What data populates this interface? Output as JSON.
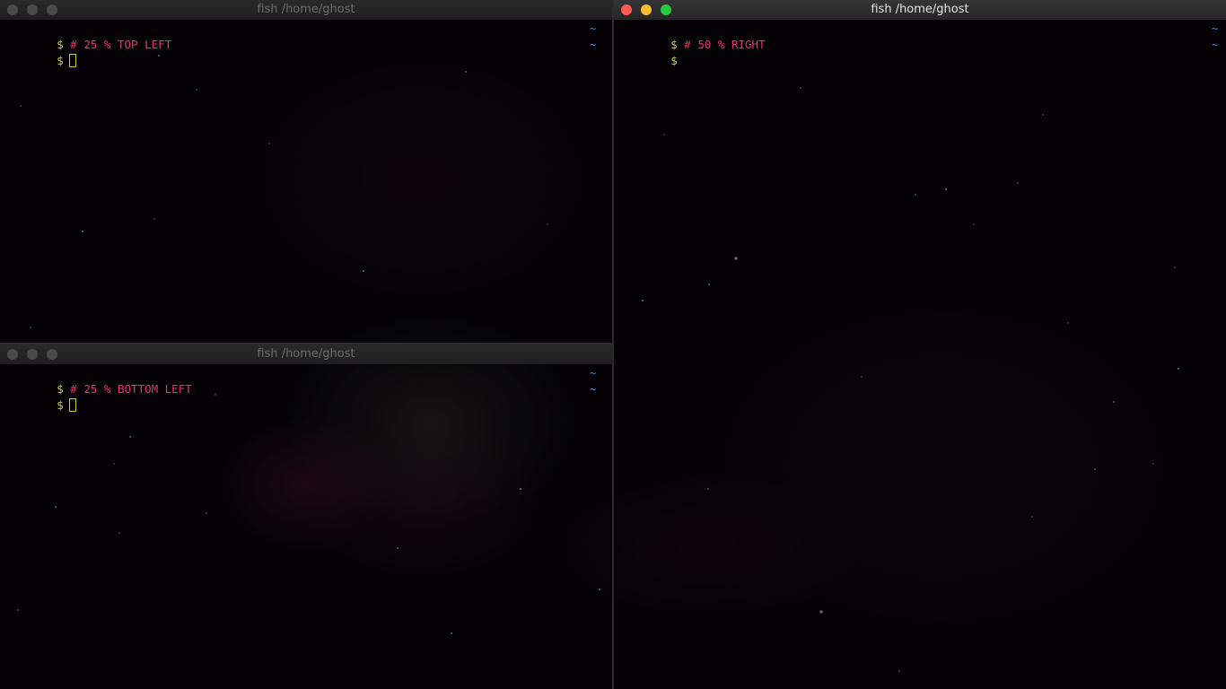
{
  "terminals": {
    "top_left": {
      "title": "fish  /home/ghost",
      "state": "inactive",
      "line1_prompt": "$",
      "line1_command": "# 25 % TOP LEFT",
      "line2_prompt": "$",
      "right_prompt_1": "~",
      "right_prompt_2": "~"
    },
    "bottom_left": {
      "title": "fish  /home/ghost",
      "state": "inactive",
      "line1_prompt": "$",
      "line1_command": "# 25 % BOTTOM LEFT",
      "line2_prompt": "$",
      "right_prompt_1": "~",
      "right_prompt_2": "~"
    },
    "right": {
      "title": "fish  /home/ghost",
      "state": "active",
      "line1_prompt": "$",
      "line1_command": "# 50 % RIGHT",
      "line2_prompt": "$",
      "right_prompt_1": "~",
      "right_prompt_2": "~"
    }
  },
  "colors": {
    "prompt": "#c6d03a",
    "command": "#e8336c",
    "right_prompt": "#3a8be0",
    "close_button": "#ff5b55",
    "minimize_button": "#f7bd2e",
    "maximize_button": "#28c840",
    "inactive_button": "#4a4a4a"
  },
  "icons": {
    "close": "close-button-icon",
    "minimize": "minimize-button-icon",
    "maximize": "maximize-button-icon",
    "cursor": "block-cursor-icon"
  }
}
